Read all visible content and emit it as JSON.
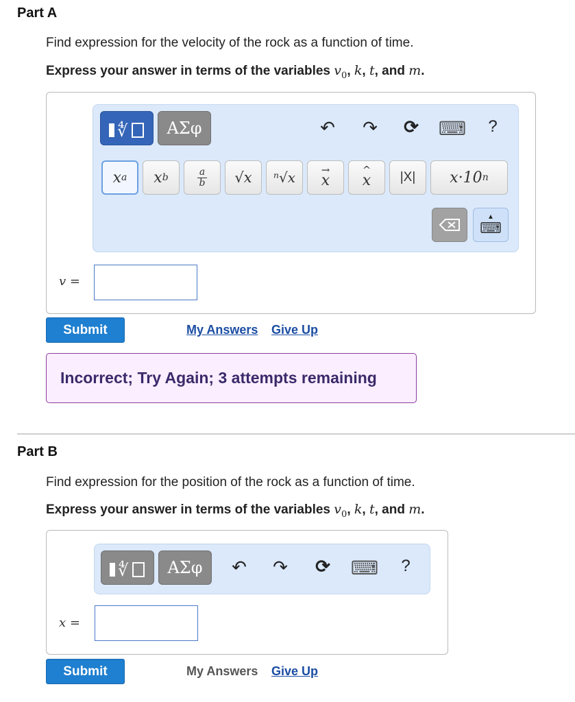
{
  "partA": {
    "title": "Part A",
    "prompt": "Find expression for the velocity of the rock as a function of time.",
    "express_prefix": "Express your answer in terms of the variables ",
    "var1": "v",
    "var1_sub": "0",
    "sep1": ", ",
    "var2": "k",
    "sep2": ", ",
    "var3": "t",
    "sep3": ", and ",
    "var4": "m",
    "end": ".",
    "toolbar": {
      "greek_label": "ΑΣφ",
      "undo_icon": "↶",
      "redo_icon": "↷",
      "reset_icon": "⟳",
      "keyboard_icon": "⌨",
      "help_label": "?",
      "keys": [
        "x",
        "a",
        "x",
        "b",
        "a",
        "b",
        "√x",
        "ⁿ√x",
        "x",
        "x",
        "|X|",
        "x·10",
        "n"
      ]
    },
    "equation_label": "v =",
    "input_value": "",
    "submit_label": "Submit",
    "my_answers_label": "My Answers",
    "give_up_label": "Give Up",
    "feedback": "Incorrect; Try Again; 3 attempts remaining"
  },
  "partB": {
    "title": "Part B",
    "prompt": "Find expression for the position of the rock as a function of time.",
    "express_prefix": "Express your answer in terms of the variables ",
    "var1": "v",
    "var1_sub": "0",
    "sep1": ", ",
    "var2": "k",
    "sep2": ", ",
    "var3": "t",
    "sep3": ", and ",
    "var4": "m",
    "end": ".",
    "toolbar": {
      "greek_label": "ΑΣφ",
      "undo_icon": "↶",
      "redo_icon": "↷",
      "reset_icon": "⟳",
      "keyboard_icon": "⌨",
      "help_label": "?"
    },
    "equation_label": "x =",
    "input_value": "",
    "submit_label": "Submit",
    "my_answers_label": "My Answers",
    "give_up_label": "Give Up"
  },
  "colors": {
    "accent_blue": "#1f7fd0",
    "toolbar_bg": "#dbe9fb",
    "feedback_bg": "#fbeeff",
    "feedback_border": "#8a3d9e"
  }
}
